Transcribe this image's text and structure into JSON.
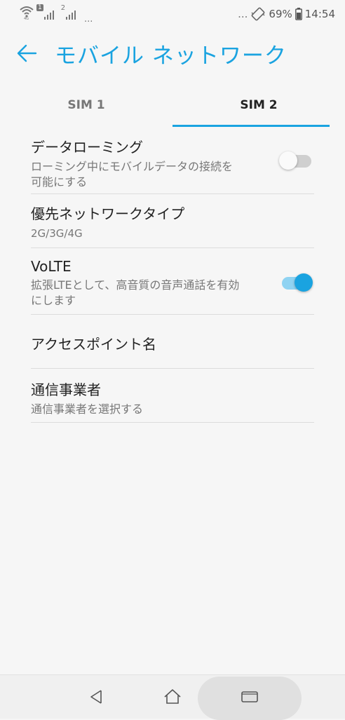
{
  "status_bar": {
    "sim1_badge": "1",
    "sim2_badge": "2",
    "overflow": "...",
    "more_notifications": "...",
    "battery_percent": "69%",
    "time": "14:54"
  },
  "header": {
    "title": "モバイル ネットワーク"
  },
  "tabs": [
    {
      "label": "SIM 1",
      "selected": false
    },
    {
      "label": "SIM 2",
      "selected": true
    }
  ],
  "settings": [
    {
      "title": "データローミング",
      "summary": "ローミング中にモバイルデータの接続を可能にする",
      "toggle": "off"
    },
    {
      "title": "優先ネットワークタイプ",
      "summary": "2G/3G/4G"
    },
    {
      "title": "VoLTE",
      "summary": "拡張LTEとして、高音質の音声通話を有効にします",
      "toggle": "on"
    },
    {
      "title": "アクセスポイント名",
      "summary": ""
    },
    {
      "title": "通信事業者",
      "summary": "通信事業者を選択する"
    }
  ],
  "colors": {
    "accent": "#1aa3e0",
    "toggle_on_track": "#8fd3f2",
    "toggle_off_track": "#cfcfcf",
    "background": "#f6f6f6"
  },
  "nav_bar": {
    "back": "back-icon",
    "home": "home-icon",
    "recents": "recents-icon"
  }
}
